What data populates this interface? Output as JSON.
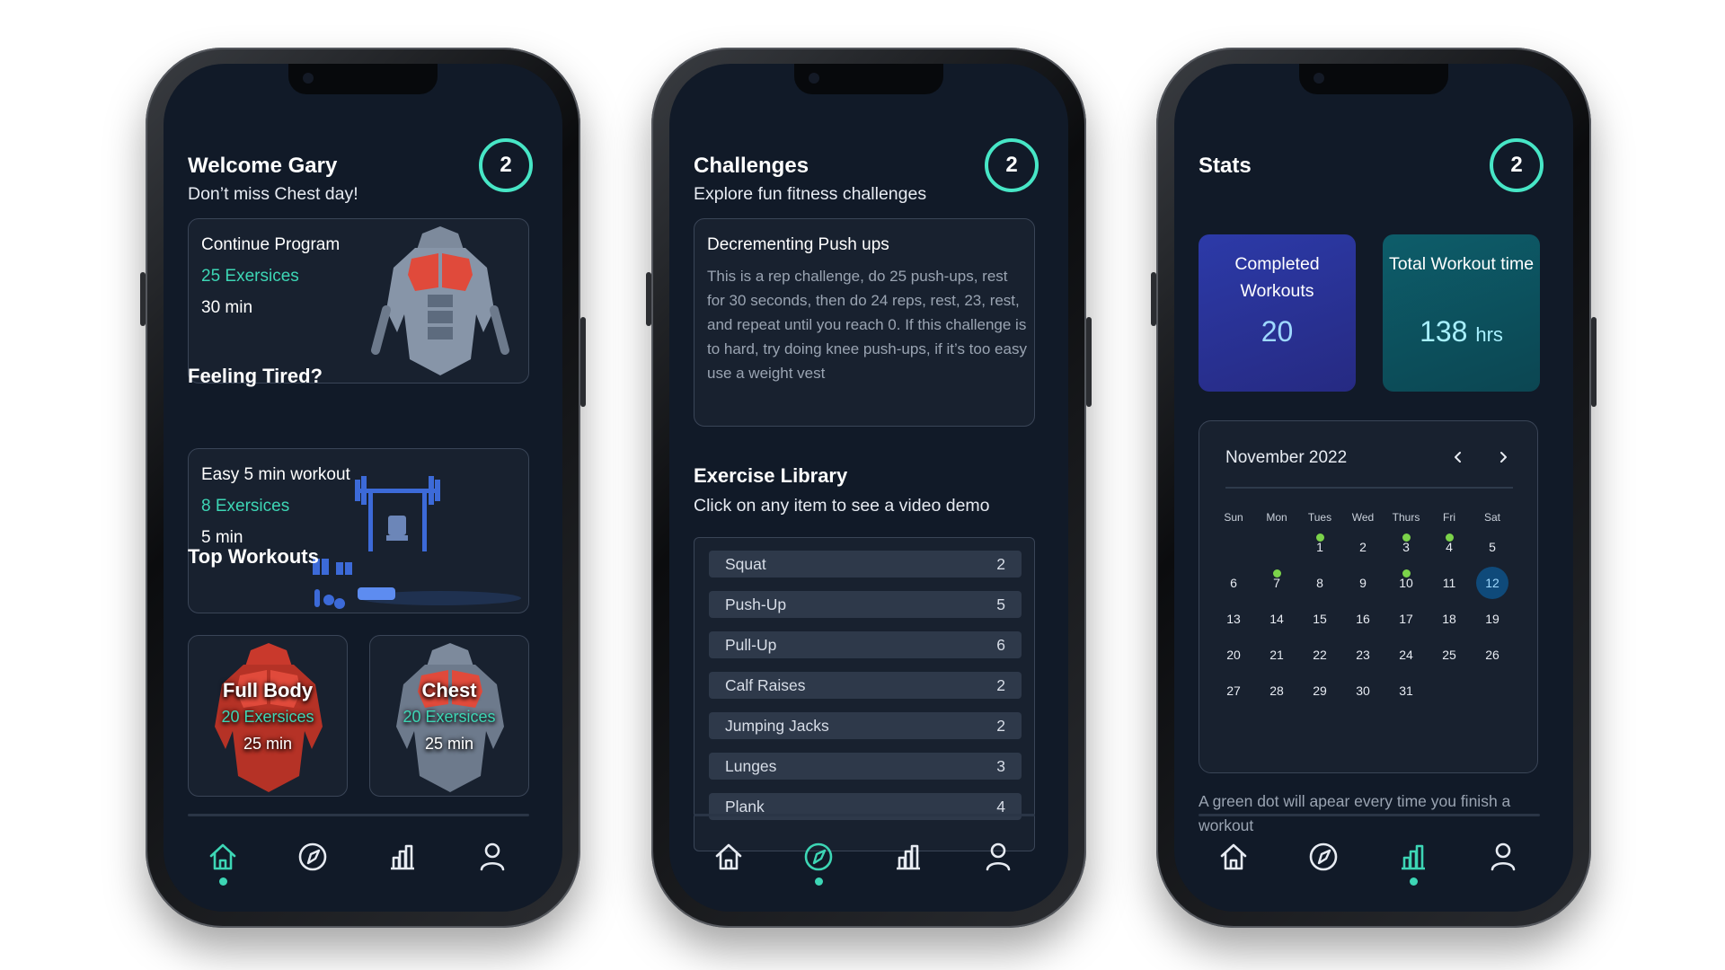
{
  "screens": {
    "home": {
      "title": "Welcome Gary",
      "subtitle": "Don’t miss Chest day!",
      "badge": "2",
      "continue_card": {
        "title": "Continue Program",
        "exercises": "25 Exersices",
        "duration": "30 min"
      },
      "tired_heading": "Feeling Tired?",
      "easy_card": {
        "title": "Easy 5 min workout",
        "exercises": "8 Exersices",
        "duration": "5 min"
      },
      "top_heading": "Top Workouts",
      "workouts": [
        {
          "name": "Full Body",
          "exercises": "20 Exersices",
          "duration": "25 min"
        },
        {
          "name": "Chest",
          "exercises": "20 Exersices",
          "duration": "25 min"
        }
      ]
    },
    "challenges": {
      "title": "Challenges",
      "subtitle": "Explore fun fitness challenges",
      "badge": "2",
      "challenge": {
        "title": "Decrementing Push ups",
        "description": "This is a rep challenge, do 25 push-ups, rest for 30 seconds, then do 24 reps, rest, 23, rest, and repeat until you reach 0. If this challenge is to hard, try doing knee push-ups, if it’s too easy use a weight vest"
      },
      "library_heading": "Exercise Library",
      "library_subtitle": "Click on any item to see a video demo",
      "library": [
        {
          "name": "Squat",
          "count": "2"
        },
        {
          "name": "Push-Up",
          "count": "5"
        },
        {
          "name": "Pull-Up",
          "count": "6"
        },
        {
          "name": "Calf Raises",
          "count": "2"
        },
        {
          "name": "Jumping Jacks",
          "count": "2"
        },
        {
          "name": "Lunges",
          "count": "3"
        },
        {
          "name": "Plank",
          "count": "4"
        }
      ]
    },
    "stats": {
      "title": "Stats",
      "badge": "2",
      "completed_label": "Completed Workouts",
      "completed_value": "20",
      "total_label": "Total Workout time",
      "total_value": "138",
      "total_unit": "hrs",
      "calendar": {
        "month": "November 2022",
        "weekdays": [
          "Sun",
          "Mon",
          "Tues",
          "Wed",
          "Thurs",
          "Fri",
          "Sat"
        ],
        "days": [
          "1",
          "2",
          "3",
          "4",
          "5",
          "6",
          "7",
          "8",
          "9",
          "10",
          "11",
          "12",
          "13",
          "14",
          "15",
          "16",
          "17",
          "18",
          "19",
          "20",
          "21",
          "22",
          "23",
          "24",
          "25",
          "26",
          "27",
          "28",
          "29",
          "30",
          "31"
        ],
        "today": "12",
        "workout_days": [
          "1",
          "3",
          "4",
          "7",
          "10"
        ]
      },
      "note": "A green dot will apear every time you finish a workout"
    }
  },
  "nav_icons": [
    "home-icon",
    "explore-icon",
    "stats-icon",
    "profile-icon"
  ],
  "colors": {
    "accent": "#3dd6b5",
    "background": "#111a28",
    "card": "#18212f",
    "completed_card": "#2b2f8f",
    "total_card": "#0d4f5a",
    "workout_dot": "#7bd34a"
  }
}
